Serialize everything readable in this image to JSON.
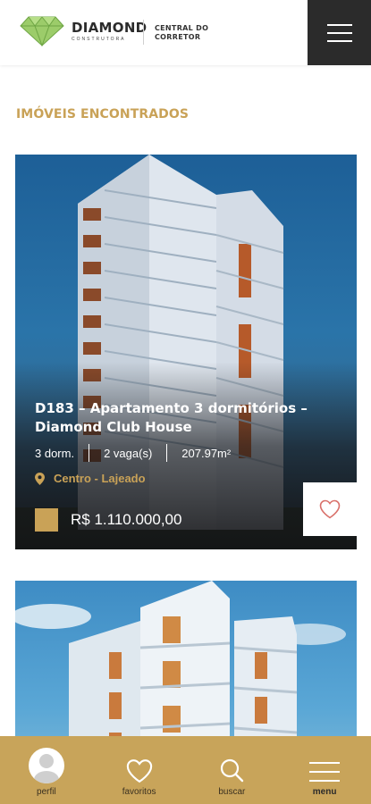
{
  "header": {
    "logo_name": "DIAMOND",
    "logo_sub": "CONSTRUTORA",
    "central_line1": "CENTRAL DO",
    "central_line2": "CORRETOR",
    "menu_icon": "hamburger-icon"
  },
  "section": {
    "title": "IMÓVEIS ENCONTRADOS"
  },
  "listings": [
    {
      "title": "D183 – Apartamento 3 dormitórios – Diamond Club House",
      "bedrooms": "3 dorm.",
      "parking": "2 vaga(s)",
      "area": "207.97m²",
      "location": "Centro - Lajeado",
      "price": "R$ 1.110.000,00",
      "favorite_icon": "heart-outline-icon"
    }
  ],
  "bottom_nav": {
    "items": [
      {
        "label": "perfil",
        "icon": "avatar-icon"
      },
      {
        "label": "favoritos",
        "icon": "heart-icon"
      },
      {
        "label": "buscar",
        "icon": "search-icon"
      },
      {
        "label": "menu",
        "icon": "hamburger-icon"
      }
    ]
  },
  "colors": {
    "accent_gold": "#c9a257",
    "nav_bg": "#c8a45a",
    "dark": "#2b2b2b",
    "logo_green": "#8dc25a"
  }
}
